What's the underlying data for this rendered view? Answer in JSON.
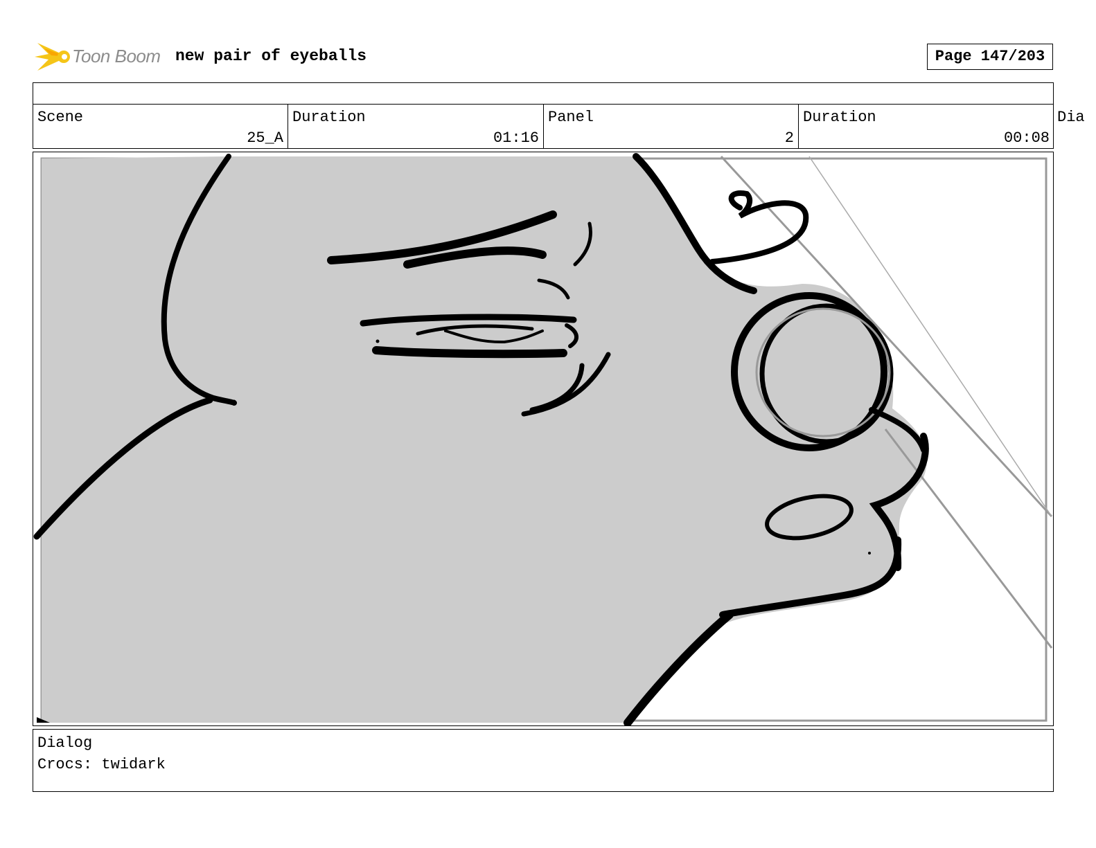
{
  "header": {
    "brand": "Toon Boom",
    "project_title": "new pair of eyeballs",
    "page_label": "Page 147/203"
  },
  "fields": {
    "scene_label": "Scene",
    "scene_value": "25_A",
    "scene_duration_label": "Duration",
    "scene_duration_value": "01:16",
    "panel_label": "Panel",
    "panel_value": "2",
    "panel_duration_label": "Duration",
    "panel_duration_value": "00:08",
    "overflow_label": "Dia"
  },
  "dialog": {
    "label": "Dialog",
    "text": "Crocs: twidark"
  },
  "colors": {
    "sketch_fill": "#cccccc",
    "sketch_line": "#000000",
    "logo_yellow": "#f5c518",
    "logo_text": "#8c8c8c"
  }
}
